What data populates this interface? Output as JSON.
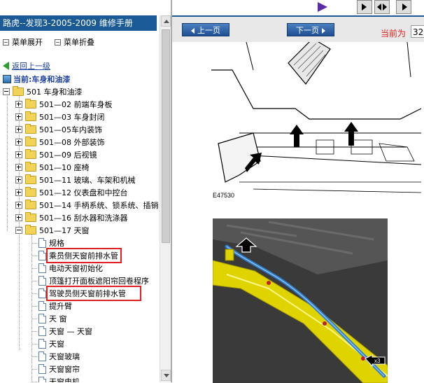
{
  "left": {
    "title": "路虎--发现3-2005-2009 维修手册",
    "menu_expand": "菜单展开",
    "menu_collapse": "菜单折叠",
    "back_label": "返回上一级",
    "current_label": "当前:车身和油漆",
    "tree": {
      "root": "501 车身和油漆",
      "folders": [
        "501—02 前端车身板",
        "501—03 车身封闭",
        "501—05车内装饰",
        "501—08 外部装饰",
        "501—09 后视镜",
        "501—10 座椅",
        "501—11 玻璃、车架和机械",
        "501—12 仪表盘和中控台",
        "501—14 手柄系统、锁系统、插销",
        "501—16 刮水器和洗涤器",
        "501—17 天窗"
      ],
      "docs": [
        "规格",
        "乘员侧天窗前排水管",
        "电动天窗初始化",
        "顶篷打开面板遮阳帘回卷程序",
        "驾驶员侧天窗前排水管",
        "提升臂",
        "天 窗",
        "天窗 — 天窗",
        "天窗",
        "天窗玻璃",
        "天窗窗帘",
        "天窗电机"
      ]
    }
  },
  "right": {
    "prev_label": "上一页",
    "next_label": "下一页",
    "current_page_label": "当前为",
    "current_page": "32",
    "figure1_code": "E47530",
    "callout": "x3"
  },
  "colors": {
    "title_bg": "#1a5a96",
    "highlight_box": "#e02020",
    "drain_tube": "#2f7fd0",
    "roof_frame": "#e0d400"
  }
}
